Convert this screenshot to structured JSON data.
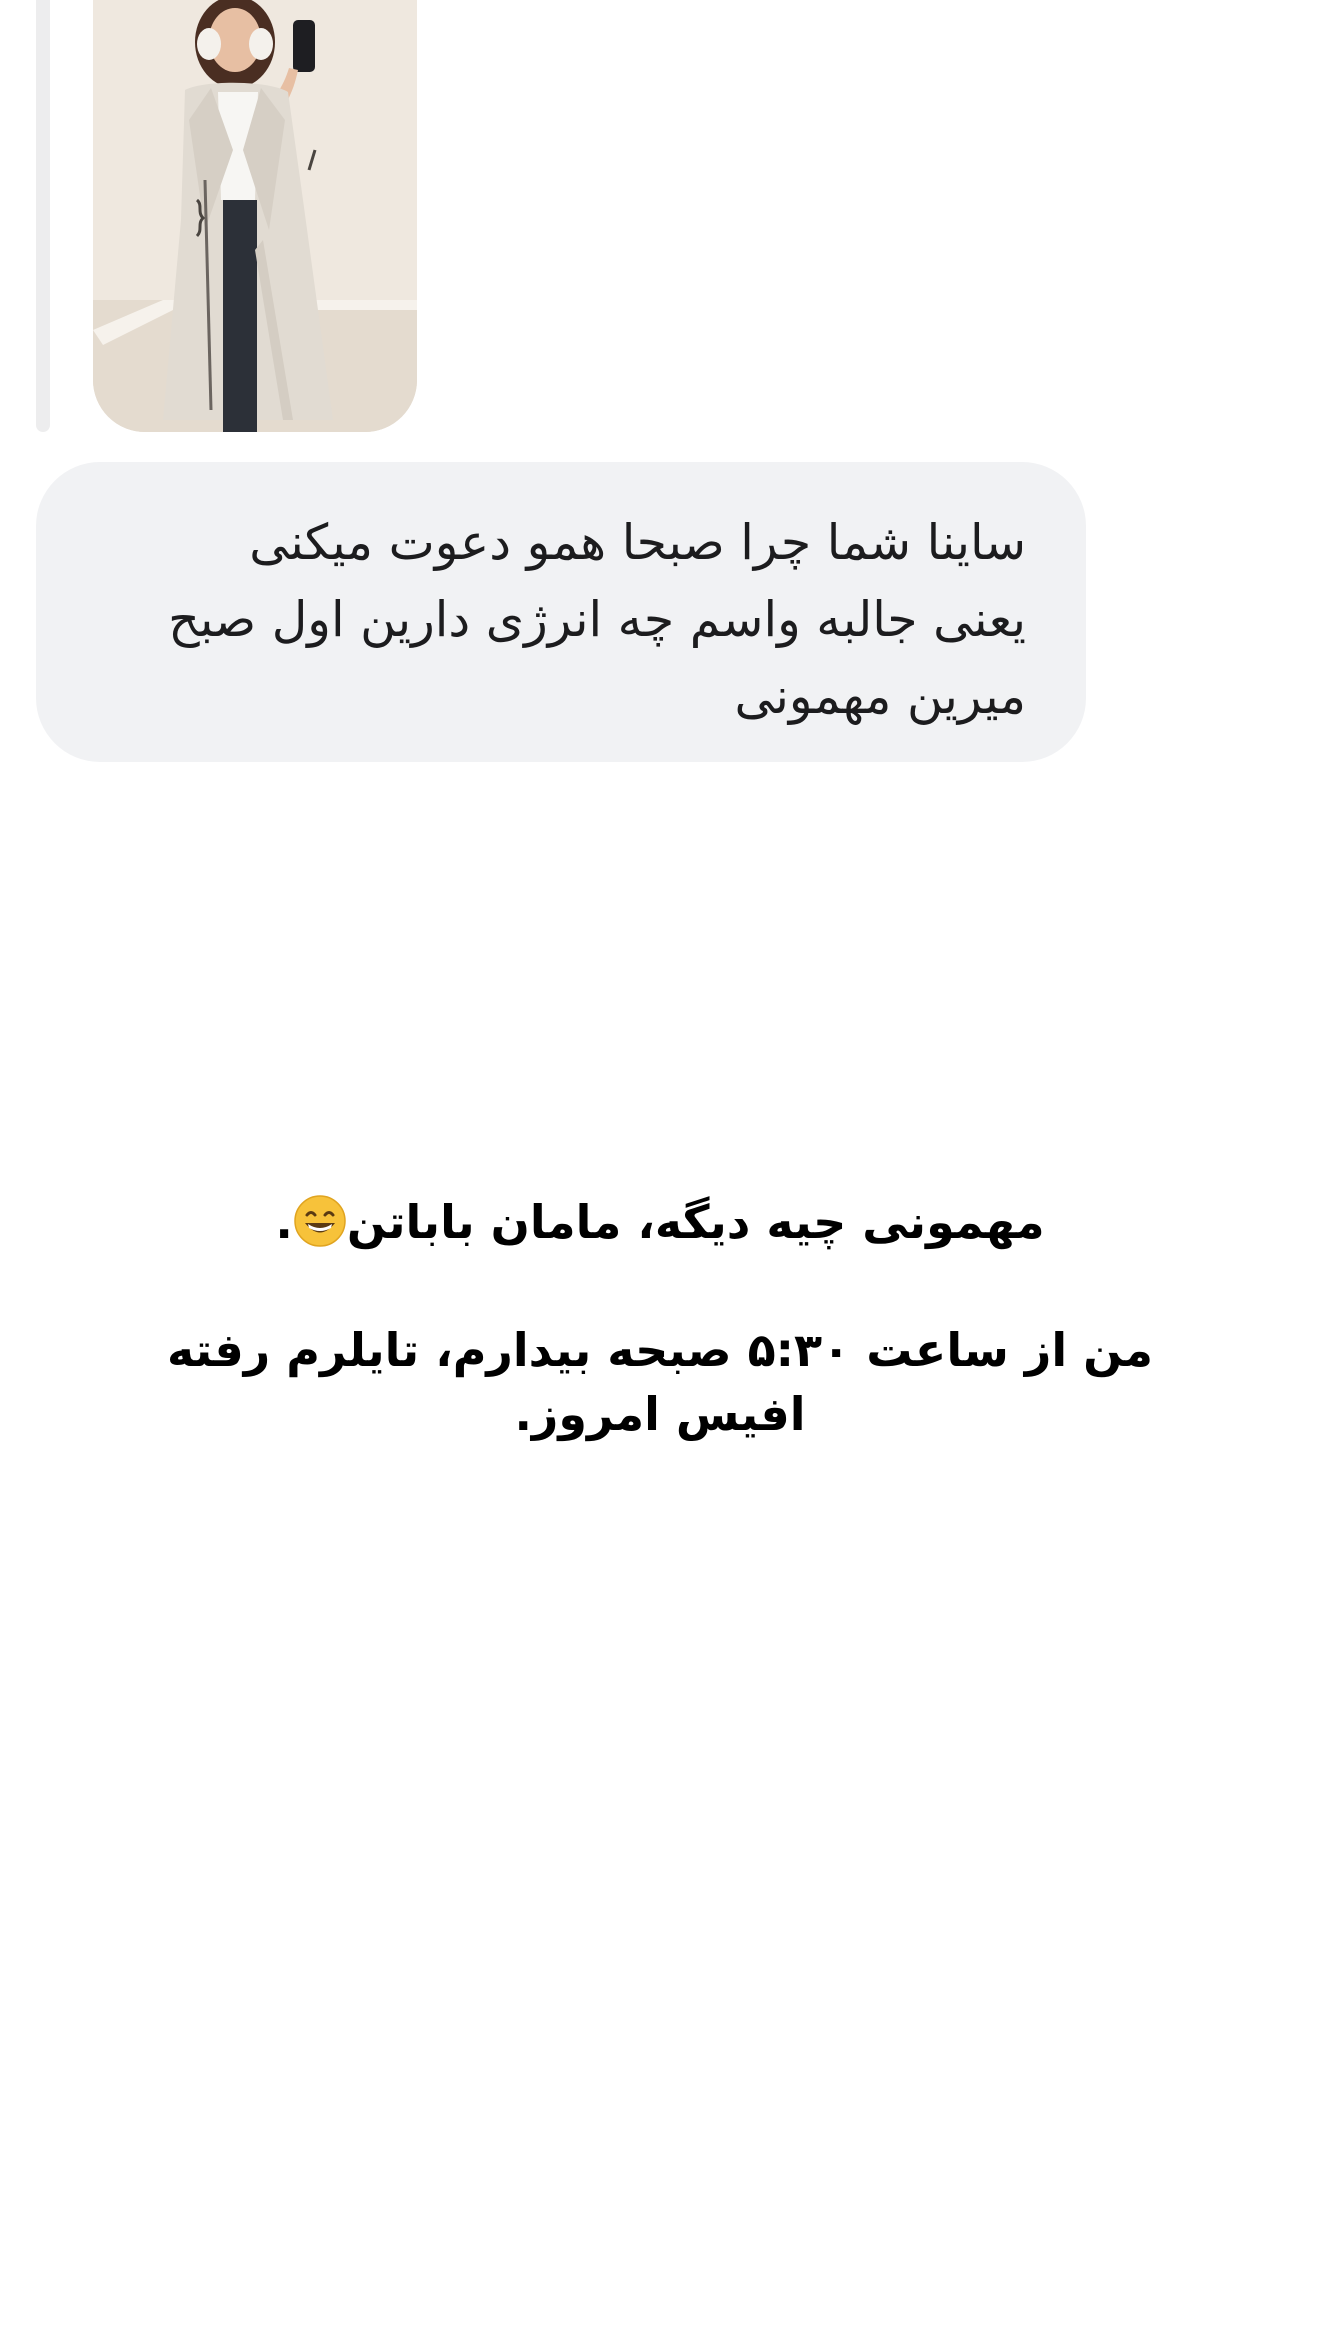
{
  "message": {
    "lines": [
      "ساینا شما چرا صبحا همو دعوت میکنی",
      "یعنی جالبه واسم چه انرژی دارین اول صبح",
      "میرین مهمونی"
    ]
  },
  "caption": {
    "paragraph1": {
      "text_before_emoji": "مهمونی چیه دیگه، مامان باباتن",
      "emoji": "grinning-face-with-smiling-eyes-emoji",
      "text_after_emoji": "."
    },
    "paragraph2": {
      "lines": [
        "من از ساعت ۵:۳۰ صبحه بیدارم، تایلرم رفته",
        "افیس امروز."
      ]
    }
  },
  "colors": {
    "bubble_bg": "#f1f2f4",
    "reply_bar": "#ededee",
    "text": "#1c1c1e"
  }
}
